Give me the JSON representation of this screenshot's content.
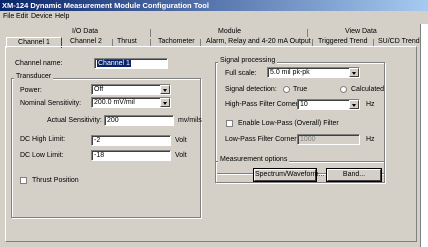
{
  "window": {
    "title": "XM-124 Dynamic Measurement Module Configuration Tool"
  },
  "menu": [
    "File",
    "Edit",
    "Device",
    "Help"
  ],
  "tabs_top": [
    "I/O Data",
    "Module",
    "View Data"
  ],
  "tabs_bottom": [
    "Channel 1",
    "Channel 2",
    "Thrust",
    "Tachometer",
    "Alarm, Relay and 4-20 mA Output",
    "Triggered Trend",
    "SU/CD Trend"
  ],
  "channel": {
    "name_label": "Channel name:",
    "name_value": "Channel 1"
  },
  "transducer": {
    "title": "Transducer",
    "power_label": "Power:",
    "power_value": "Off",
    "nominal_label": "Nominal Sensitivity:",
    "nominal_value": "200.0 mV/mil",
    "actual_label": "Actual Sensitivity:",
    "actual_value": "200",
    "actual_unit": "mv/mils",
    "dc_high_label": "DC High Limit:",
    "dc_high_value": "-2",
    "dc_high_unit": "Volt",
    "dc_low_label": "DC Low Limit:",
    "dc_low_value": "-18",
    "dc_low_unit": "Volt",
    "thrust_label": "Thrust Position"
  },
  "signal": {
    "title": "Signal processing",
    "fullscale_label": "Full scale:",
    "fullscale_value": "5.0 mil pk-pk",
    "detection_label": "Signal detection:",
    "true_label": "True",
    "calculated_label": "Calculated",
    "hp_label": "High-Pass Filter Corner:",
    "hp_value": "10",
    "hp_unit": "Hz",
    "lp_enable_label": "Enable Low-Pass (Overall) Filter",
    "lp_label": "Low-Pass Filter Corner:",
    "lp_value": "1000",
    "lp_unit": "Hz"
  },
  "measurement": {
    "title": "Measurement options",
    "spectrum_label": "Spectrum/Waveform...",
    "band_label": "Band..."
  }
}
